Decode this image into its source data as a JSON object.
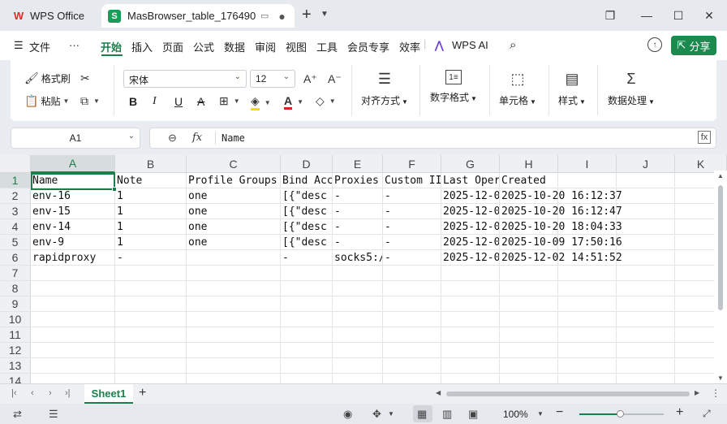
{
  "titlebar": {
    "app_tab_label": "WPS Office",
    "doc_tab_label": "MasBrowser_table_176490",
    "doc_tab_icon_letter": "S"
  },
  "menu": {
    "file": "文件",
    "more": "···",
    "items": [
      "开始",
      "插入",
      "页面",
      "公式",
      "数据",
      "审阅",
      "视图",
      "工具",
      "会员专享",
      "效率"
    ],
    "active": "开始",
    "wps_ai": "WPS AI",
    "share": "分享"
  },
  "ribbon": {
    "format_painter": "格式刷",
    "paste": "粘贴",
    "font_name": "宋体",
    "font_size": "12",
    "align": "对齐方式",
    "number_format": "数字格式",
    "cell": "单元格",
    "style": "样式",
    "data_process": "数据处理",
    "bold": "B",
    "italic": "I",
    "underline": "U",
    "strike": "A",
    "font_grow": "A⁺",
    "font_shrink": "A⁻"
  },
  "formula_bar": {
    "cell_ref": "A1",
    "fx": "fx",
    "value": "Name"
  },
  "grid": {
    "columns": [
      "A",
      "B",
      "C",
      "D",
      "E",
      "F",
      "G",
      "H",
      "I",
      "J",
      "K"
    ],
    "rows": [
      "1",
      "2",
      "3",
      "4",
      "5",
      "6",
      "7",
      "8",
      "9",
      "10",
      "11",
      "12",
      "13",
      "14"
    ],
    "data": [
      [
        "Name",
        "Note",
        "Profile Groups",
        "Bind Acc",
        "Proxies",
        "Custom II",
        "Last Oper",
        "Created",
        "",
        "",
        ""
      ],
      [
        "env-16",
        "1",
        "one",
        "[{\"desc",
        "-",
        "-",
        "2025-12-0",
        "2025-10-20  16:12:37",
        "",
        "",
        ""
      ],
      [
        "env-15",
        "1",
        "one",
        "[{\"desc",
        "-",
        "-",
        "2025-12-0",
        "2025-10-20  16:12:47",
        "",
        "",
        ""
      ],
      [
        "env-14",
        "1",
        "one",
        "[{\"desc",
        "-",
        "-",
        "2025-12-0",
        "2025-10-20  18:04:33",
        "",
        "",
        ""
      ],
      [
        "env-9",
        "1",
        "one",
        "[{\"desc",
        "-",
        "-",
        "2025-12-0",
        "2025-10-09  17:50:16",
        "",
        "",
        ""
      ],
      [
        "rapidproxy",
        "-",
        "",
        "-",
        "socks5:/",
        "-",
        "2025-12-0",
        "2025-12-02  14:51:52",
        "",
        "",
        ""
      ]
    ]
  },
  "sheets": {
    "active": "Sheet1"
  },
  "status": {
    "zoom": "100%",
    "zoom_value": 100
  }
}
